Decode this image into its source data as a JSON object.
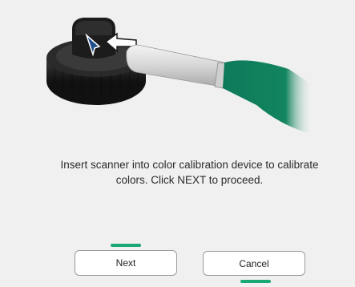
{
  "instruction": {
    "line1": "Insert scanner into color calibration device to calibrate",
    "line2": "colors.  Click NEXT to proceed."
  },
  "buttons": {
    "next_label": "Next",
    "cancel_label": "Cancel"
  },
  "colors": {
    "accent": "#1aa874",
    "scanner_tip": "#0e7a5a",
    "device_body": "#1e1e1e",
    "arrow_fill": "#ffffff",
    "marker_fill": "#1f4e8c",
    "background": "#f0f0f0"
  },
  "icons": {
    "calibration_device": "calibration-device-icon",
    "scanner": "scanner-wand-icon",
    "insert_arrow": "insert-arrow-icon",
    "device_marker": "device-marker-icon"
  }
}
